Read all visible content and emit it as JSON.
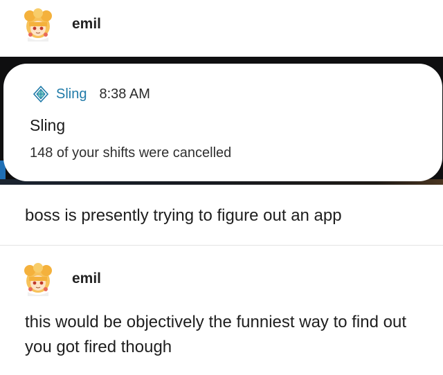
{
  "posts": [
    {
      "username": "emil",
      "embed": {
        "notification": {
          "app_name": "Sling",
          "time": "8:38 AM",
          "title": "Sling",
          "body": "148 of your shifts were cancelled"
        }
      },
      "text": "boss is presently trying to figure out an app"
    },
    {
      "username": "emil",
      "text": "this would be objectively the funniest way to find out you got fired though"
    }
  ],
  "icons": {
    "avatar": "avatar-illustration",
    "sling": "sling-logo-icon"
  },
  "colors": {
    "sling_accent": "#1f7aa8",
    "embed_background": "#0f0f10"
  }
}
